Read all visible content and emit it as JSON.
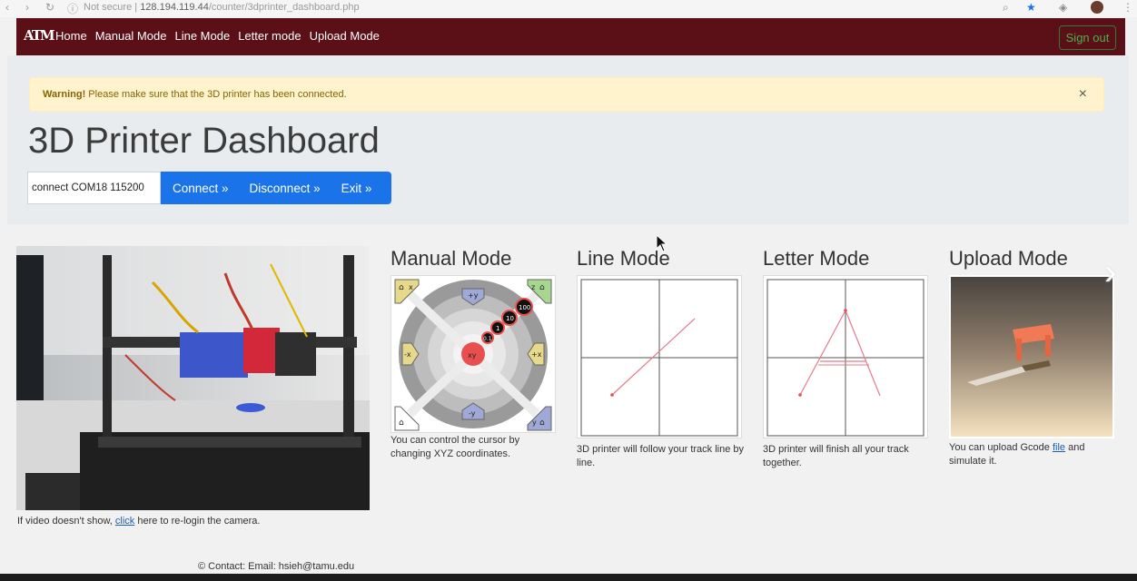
{
  "browser": {
    "url_prefix": "Not secure",
    "url_host": "128.194.119.44",
    "url_path": "/counter/3dprinter_dashboard.php"
  },
  "navbar": {
    "brand": "ATM",
    "links": [
      "Home",
      "Manual Mode",
      "Line Mode",
      "Letter mode",
      "Upload Mode"
    ],
    "signout_label": "Sign out"
  },
  "alert": {
    "strong": "Warning!",
    "message": " Please make sure that the 3D printer has been connected.",
    "close": "×"
  },
  "title": "3D Printer Dashboard",
  "command": {
    "value": "connect COM18 115200",
    "buttons": [
      "Connect »",
      "Disconnect »",
      "Exit »"
    ]
  },
  "video": {
    "caption_before": "If video doesn't show, ",
    "caption_link": "click",
    "caption_after": " here to re-login the camera."
  },
  "modes": [
    {
      "title": "Manual Mode",
      "text": "You can control the cursor by changing XYZ coordinates."
    },
    {
      "title": "Line Mode",
      "text": "3D printer will follow your track line by line."
    },
    {
      "title": "Letter Mode",
      "text": "3D printer will finish all your track together."
    },
    {
      "title": "Upload Mode",
      "text_before": "You can upload Gcode ",
      "text_link": "file",
      "text_after": " and simulate it."
    }
  ],
  "manual_pad": {
    "labels": {
      "home_x": "x",
      "home_z": "z",
      "plus_y": "+y",
      "minus_y": "-y",
      "minus_x": "-x",
      "plus_x": "+x",
      "home_y": "y",
      "center": "xy"
    },
    "steps": [
      "100",
      "10",
      "1",
      "0.1"
    ]
  },
  "footer": "© Contact: Email: hsieh@tamu.edu",
  "colors": {
    "navbar": "#5b0f16",
    "primary": "#1a73e8",
    "alert_bg": "#fff3cd",
    "signout": "#4caf50"
  }
}
